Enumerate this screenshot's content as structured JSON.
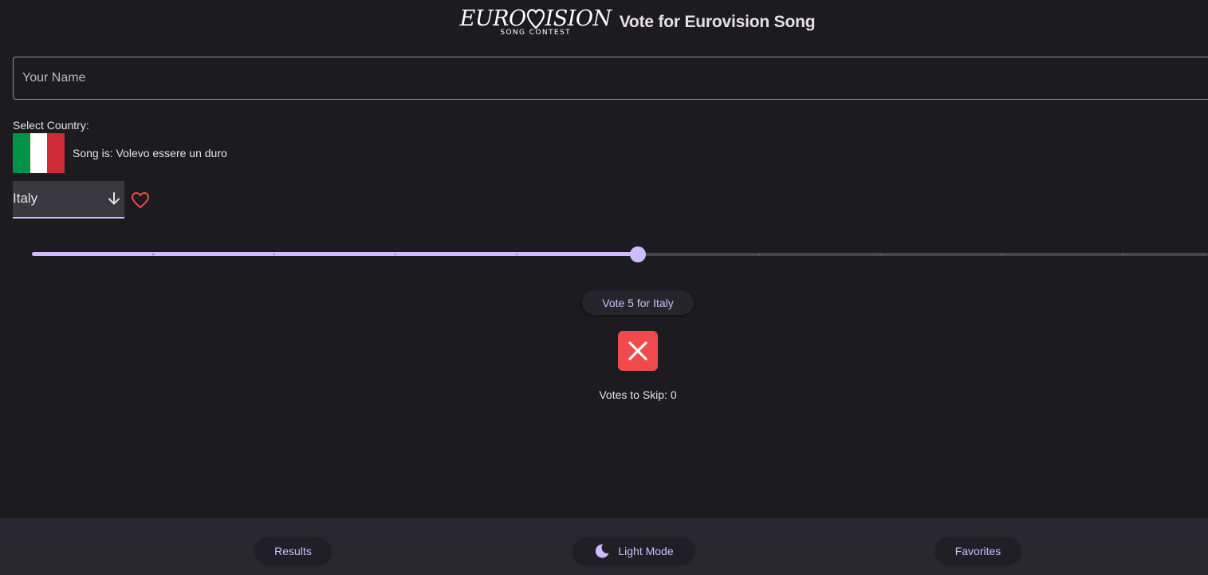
{
  "header": {
    "logo_main_left": "EURO",
    "logo_main_right": "ISION",
    "logo_sub": "SONG CONTEST",
    "title": "Vote for Eurovision Song"
  },
  "name_input": {
    "placeholder": "Your Name",
    "value": ""
  },
  "country": {
    "label": "Select Country:",
    "song_text": "Song is: Volevo essere un duro",
    "selected": "Italy",
    "flag_colors": [
      "#009246",
      "#ffffff",
      "#ce2b37"
    ],
    "dropdown_icon": "arrow-down-icon",
    "favorite_icon": "heart-outline-icon"
  },
  "slider": {
    "value": 5,
    "min": 0,
    "max": 12
  },
  "vote": {
    "button_label": "Vote 5 for Italy"
  },
  "skip": {
    "icon": "close-icon",
    "votes_label": "Votes to Skip: 0"
  },
  "bottom_nav": {
    "results_label": "Results",
    "light_mode_label": "Light Mode",
    "light_mode_icon": "moon-icon",
    "favorites_label": "Favorites"
  },
  "colors": {
    "background": "#1c1b20",
    "accent": "#cfbcff",
    "danger": "#f04a4a",
    "favorite": "#f04a4a",
    "bottom_bar": "#29272f"
  }
}
